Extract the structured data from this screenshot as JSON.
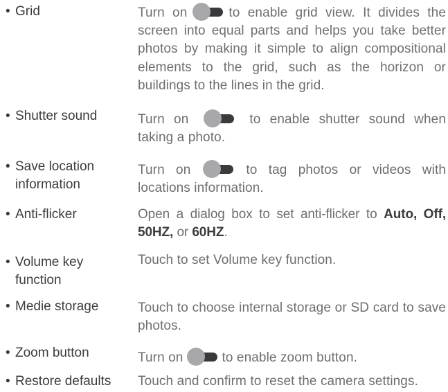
{
  "items": [
    {
      "term": "Grid",
      "desc_before": "Turn on",
      "desc_after": "to enable grid view. It divides the screen into equal parts and helps you take better photos by making it simple to align compositional elements to the grid, such as the horizon or buildings to the lines in the grid.",
      "toggle_icon": "toggle-switch-icon"
    },
    {
      "term": "Shutter sound",
      "desc_before": "Turn on",
      "desc_after": "to enable shutter sound when taking a photo.",
      "toggle_icon": "toggle-switch-icon"
    },
    {
      "term_line1": "Save location",
      "term_line2": "information",
      "desc_before": "Turn on",
      "desc_after": "to tag photos or videos with locations information.",
      "toggle_icon": "toggle-switch-icon"
    },
    {
      "term": "Anti-flicker",
      "desc_before": "Open a dialog box to set anti-flicker to",
      "opt1": "Auto, Off,",
      "opt2": "50HZ,",
      "or_text": "or",
      "opt3": "60HZ",
      "period": "."
    },
    {
      "term_line1": "Volume key",
      "term_line2": "function",
      "desc": "Touch to set Volume key function."
    },
    {
      "term": "Medie storage",
      "desc": "Touch to choose internal storage or SD card to save photos."
    },
    {
      "term": "Zoom button",
      "desc_before": "Turn on",
      "desc_after": "to enable zoom button.",
      "toggle_icon": "toggle-switch-icon"
    },
    {
      "term": "Restore defaults",
      "desc": "Touch and confirm to reset the camera settings."
    }
  ],
  "bullet": "•",
  "colors": {
    "term_text": "#3c3c3e",
    "desc_text": "#6d6e71",
    "toggle_track": "#3a3a3c",
    "toggle_knob": "#a8a8ab"
  }
}
